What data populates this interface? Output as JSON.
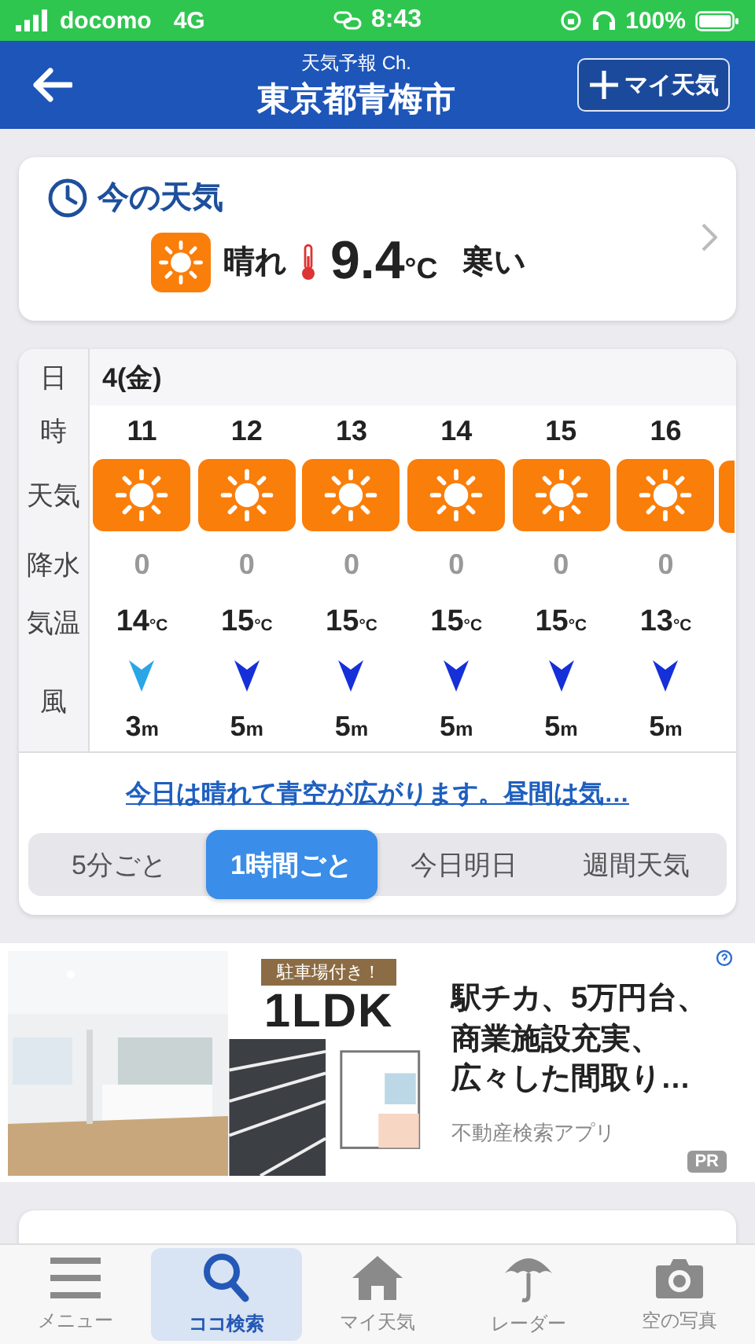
{
  "status_bar": {
    "carrier": "docomo",
    "network": "4G",
    "time": "8:43",
    "battery": "100%"
  },
  "header": {
    "subtitle": "天気予報 Ch.",
    "title": "東京都青梅市",
    "button": "マイ天気"
  },
  "current": {
    "title": "今の天気",
    "condition": {
      "kind": "sunny",
      "label": "晴れ"
    },
    "temp": "9.4",
    "temp_unit": "°C",
    "feeling": "寒い"
  },
  "hourly": {
    "labels": [
      "日",
      "時",
      "天気",
      "降水",
      "気温",
      "風"
    ],
    "date": "4(金)",
    "hours": [
      {
        "hour": "11",
        "kind": "sunny",
        "precip": "0",
        "temp": "14",
        "temp_unit": "°C",
        "color": "#2aa6e6",
        "wind": "3",
        "wind_unit": "m"
      },
      {
        "hour": "12",
        "kind": "sunny",
        "precip": "0",
        "temp": "15",
        "temp_unit": "°C",
        "color": "#1530d8",
        "wind": "5",
        "wind_unit": "m"
      },
      {
        "hour": "13",
        "kind": "sunny",
        "precip": "0",
        "temp": "15",
        "temp_unit": "°C",
        "color": "#1530d8",
        "wind": "5",
        "wind_unit": "m"
      },
      {
        "hour": "14",
        "kind": "sunny",
        "precip": "0",
        "temp": "15",
        "temp_unit": "°C",
        "color": "#1530d8",
        "wind": "5",
        "wind_unit": "m"
      },
      {
        "hour": "15",
        "kind": "sunny",
        "precip": "0",
        "temp": "15",
        "temp_unit": "°C",
        "color": "#1530d8",
        "wind": "5",
        "wind_unit": "m"
      },
      {
        "hour": "16",
        "kind": "sunny",
        "precip": "0",
        "temp": "13",
        "temp_unit": "°C",
        "color": "#1530d8",
        "wind": "5",
        "wind_unit": "m"
      }
    ]
  },
  "summary": "今日は晴れて青空が広がります。昼間は気…",
  "modes": [
    {
      "label": "5分ごと",
      "selected": false
    },
    {
      "label": "1時間ごと",
      "selected": true
    },
    {
      "label": "今日明日",
      "selected": false
    },
    {
      "label": "週間天気",
      "selected": false
    }
  ],
  "ad": {
    "badge": "駐車場付き！",
    "headline": "1LDK",
    "text_lines": [
      "駅チカ、5万円台、",
      "商業施設充実、",
      "広々した間取り…"
    ],
    "source": "不動産検索アプリ",
    "pr": "PR"
  },
  "tab_bar": [
    {
      "kind": "menu",
      "label": "メニュー",
      "selected": false
    },
    {
      "kind": "search",
      "label": "ココ検索",
      "selected": true
    },
    {
      "kind": "home",
      "label": "マイ天気",
      "selected": false
    },
    {
      "kind": "umbrella",
      "label": "レーダー",
      "selected": false
    },
    {
      "kind": "camera",
      "label": "空の写真",
      "selected": false
    }
  ]
}
